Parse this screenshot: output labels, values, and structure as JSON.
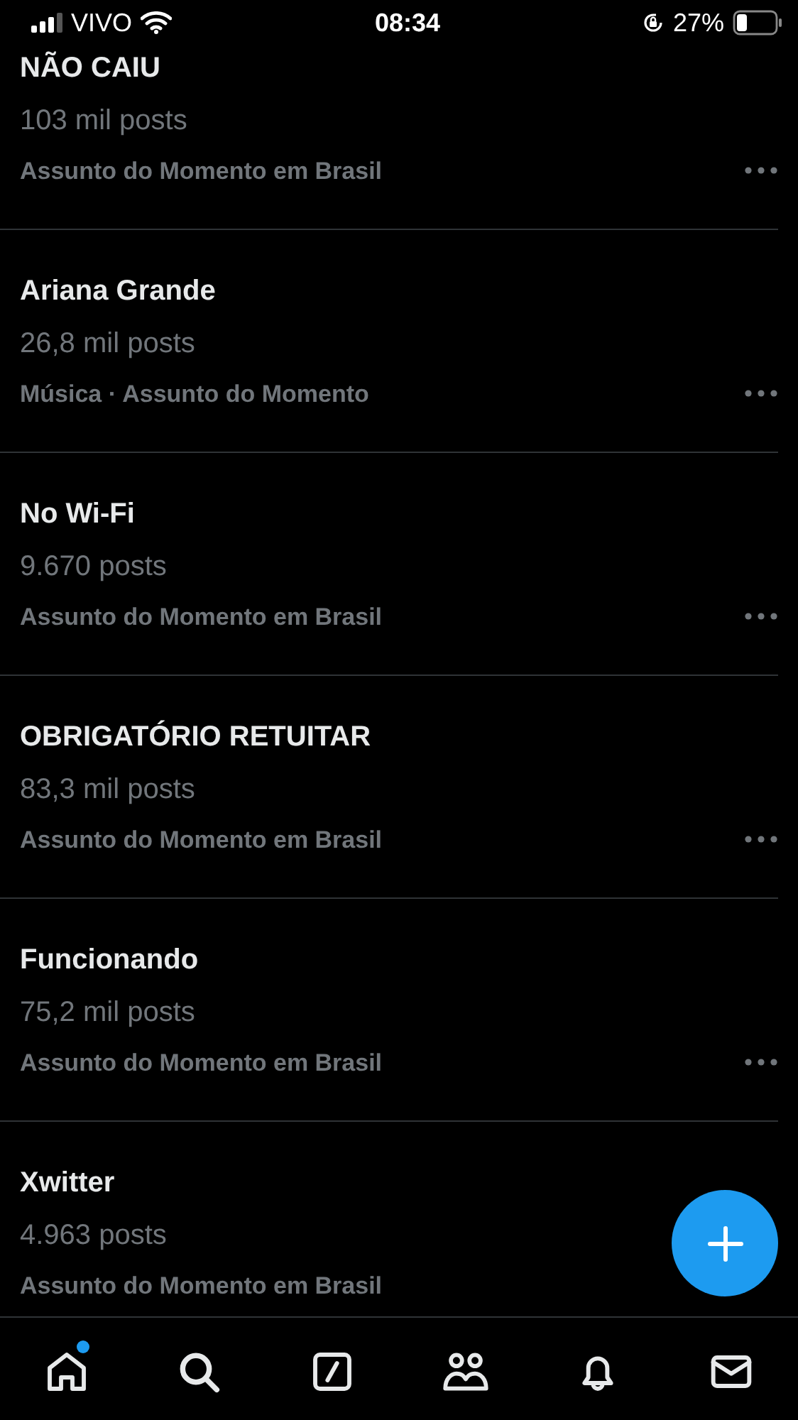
{
  "status_bar": {
    "carrier": "VIVO",
    "time": "08:34",
    "battery": "27%"
  },
  "trends": [
    {
      "title": "NÃO CAIU",
      "count": "103 mil posts",
      "category": "Assunto do Momento em Brasil",
      "more_button": true
    },
    {
      "title": "Ariana Grande",
      "count": "26,8 mil posts",
      "category": "Música · Assunto do Momento",
      "more_button": true
    },
    {
      "title": "No Wi-Fi",
      "count": "9.670 posts",
      "category": "Assunto do Momento em Brasil",
      "more_button": true
    },
    {
      "title": "OBRIGATÓRIO RETUITAR",
      "count": "83,3 mil posts",
      "category": "Assunto do Momento em Brasil",
      "more_button": true
    },
    {
      "title": "Funcionando",
      "count": "75,2 mil posts",
      "category": "Assunto do Momento em Brasil",
      "more_button": true
    },
    {
      "title": "Xwitter",
      "count": "4.963 posts",
      "category": "Assunto do Momento em Brasil",
      "more_button": false
    }
  ],
  "nav": [
    {
      "kind": "home",
      "badge": true
    },
    {
      "kind": "search",
      "badge": false
    },
    {
      "kind": "grok",
      "badge": false
    },
    {
      "kind": "communities",
      "badge": false
    },
    {
      "kind": "notifications",
      "badge": false
    },
    {
      "kind": "messages",
      "badge": false
    }
  ]
}
